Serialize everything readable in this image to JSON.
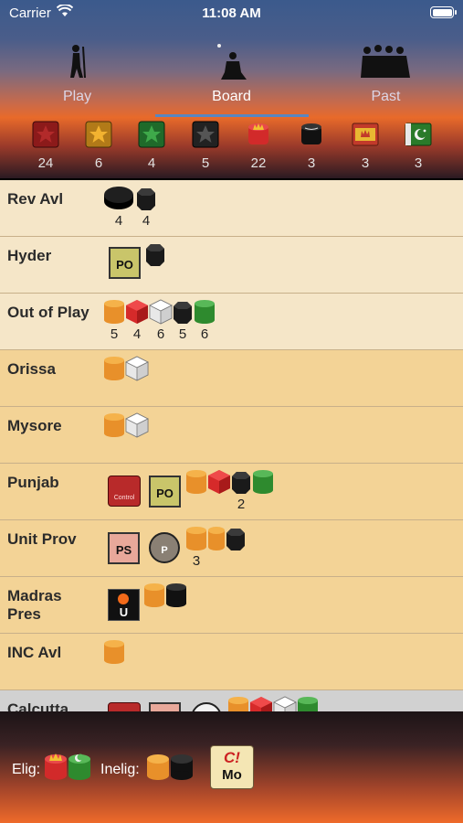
{
  "status_bar": {
    "carrier": "Carrier",
    "time": "11:08 AM"
  },
  "tabs": [
    {
      "label": "Play",
      "icon": "figure-icon",
      "active": false
    },
    {
      "label": "Board",
      "icon": "figure-icon",
      "active": true
    },
    {
      "label": "Past",
      "icon": "crowd-icon",
      "active": false
    }
  ],
  "piece_counts": [
    {
      "icon": "red-star-icon",
      "count": "24"
    },
    {
      "icon": "yellow-star-icon",
      "count": "6"
    },
    {
      "icon": "green-star-icon",
      "count": "4"
    },
    {
      "icon": "black-star-icon",
      "count": "5"
    },
    {
      "icon": "red-crown-cylinder-icon",
      "count": "22"
    },
    {
      "icon": "black-cylinder-icon",
      "count": "3"
    },
    {
      "icon": "crown-flag-icon",
      "count": "3"
    },
    {
      "icon": "crescent-flag-icon",
      "count": "3"
    }
  ],
  "rows": [
    {
      "name": "Rev Avl",
      "quantities": [
        "4",
        "4"
      ]
    },
    {
      "name": "Hyder",
      "card": "PO"
    },
    {
      "name": "Out of Play",
      "quantities": [
        "5",
        "4",
        "6",
        "5",
        "6"
      ]
    },
    {
      "name": "Orissa"
    },
    {
      "name": "Mysore"
    },
    {
      "name": "Punjab",
      "card_small": "Control",
      "card": "PO",
      "quantities": [
        "2"
      ]
    },
    {
      "name": "Unit Prov",
      "card": "PS",
      "badge": "P",
      "quantities": [
        "3"
      ]
    },
    {
      "name": "Madras Pres",
      "badge": "U"
    },
    {
      "name": "INC Avl"
    },
    {
      "name": "Calcutta"
    }
  ],
  "footer": {
    "elig_label": "Elig:",
    "inelig_label": "Inelig:",
    "button_top": "C!",
    "button_bottom": "Mo"
  },
  "colors": {
    "row_light": "#f5e6c8",
    "row_dark": "#f3d396",
    "row_grey": "#d1d1d1",
    "orange": "#f2a23a",
    "red": "#e03030",
    "white": "#f2f2f2",
    "black": "#1a1a1a",
    "green": "#3a9a3a"
  }
}
